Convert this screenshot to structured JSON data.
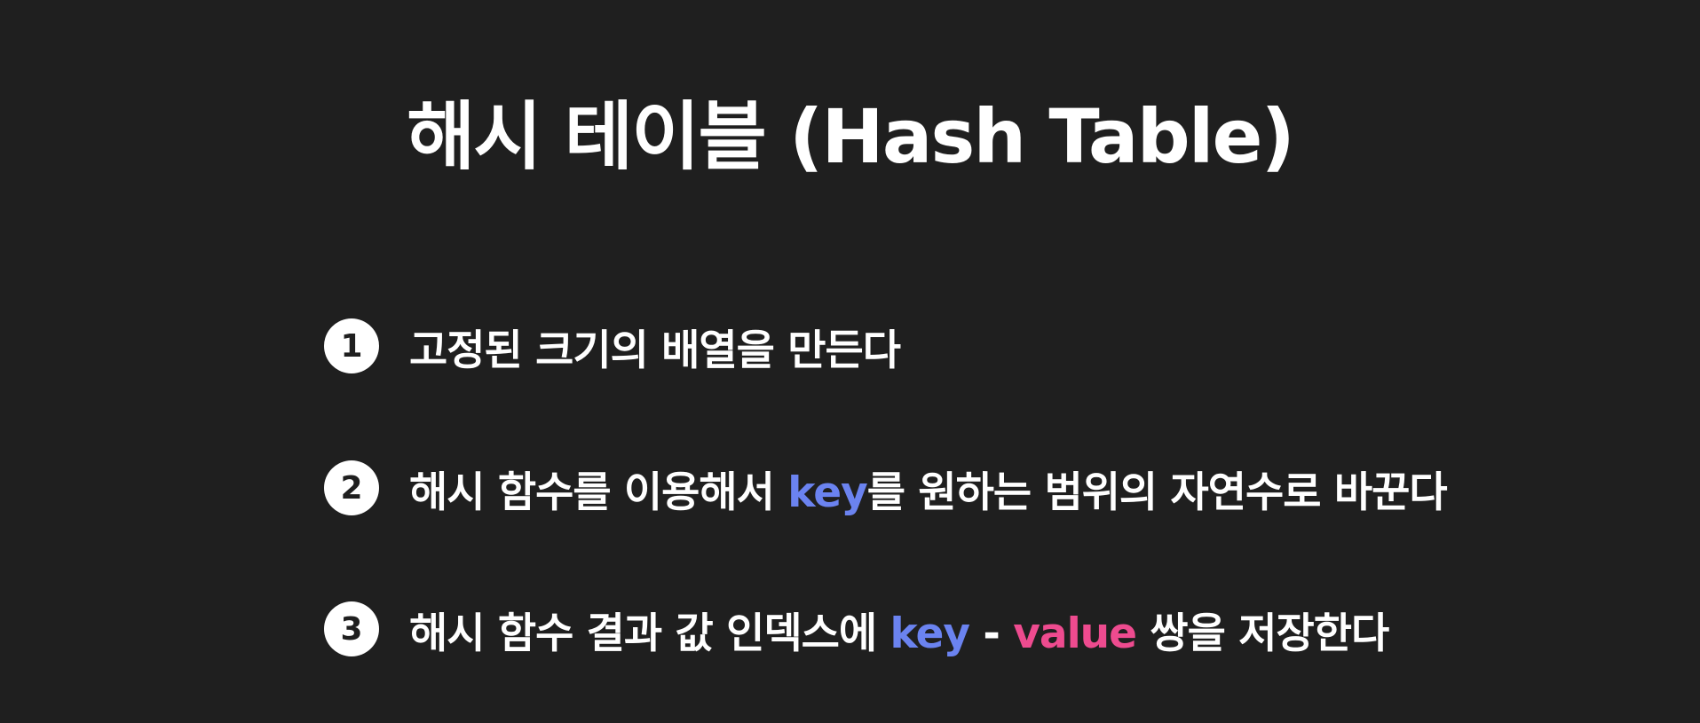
{
  "title": "해시 테이블 (Hash Table)",
  "steps": [
    {
      "number": "1",
      "text": "고정된 크기의 배열을 만든다"
    },
    {
      "number": "2",
      "before": "해시 함수를 이용해서 ",
      "key": "key",
      "after": "를 원하는 범위의 자연수로 바꾼다"
    },
    {
      "number": "3",
      "before": "해시 함수 결과 값 인덱스에 ",
      "key": "key",
      "dash": " - ",
      "value": "value",
      "after": " 쌍을 저장한다"
    }
  ],
  "colors": {
    "background": "#1f1f1f",
    "text": "#ffffff",
    "key_highlight": "#6b83f0",
    "value_highlight": "#ee4b8f"
  }
}
